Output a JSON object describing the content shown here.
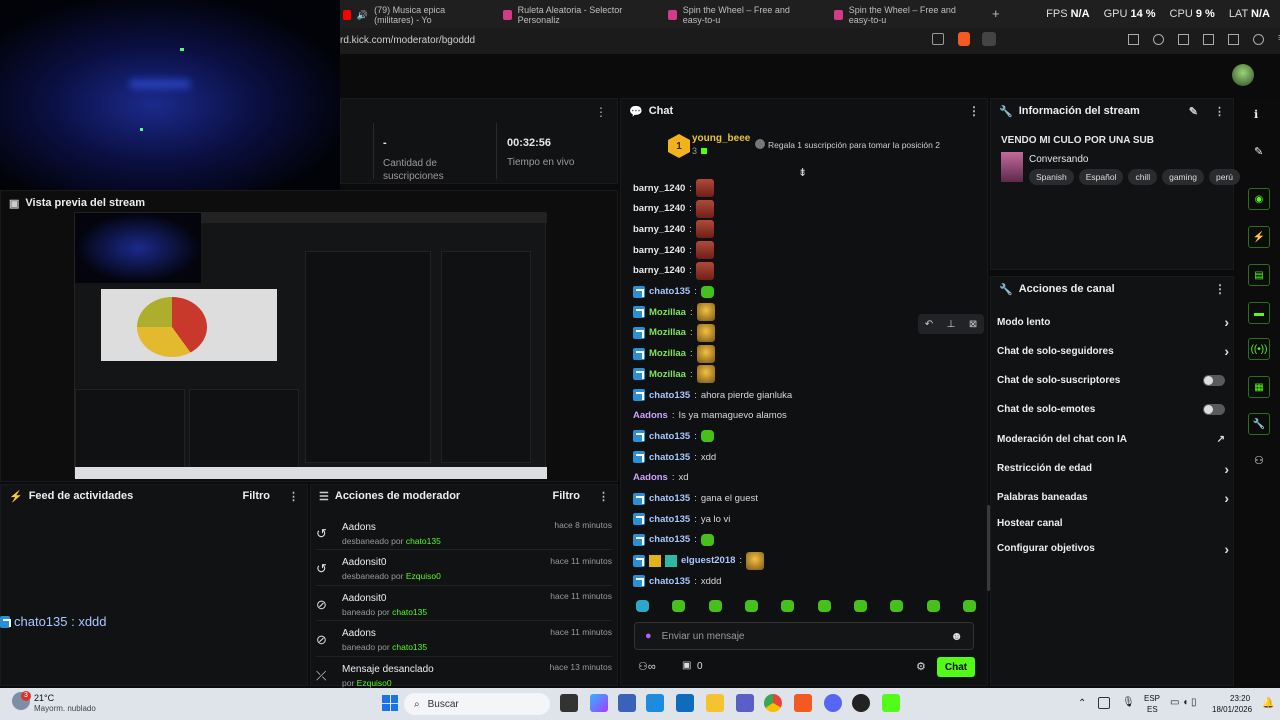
{
  "browser": {
    "tabs": [
      {
        "label": "(79) Musica epica (militares) - Yo",
        "color": "#ff0000"
      },
      {
        "label": "Ruleta Aleatoria - Selector Personaliz",
        "color": "#d23b8a"
      },
      {
        "label": "Spin the Wheel – Free and easy-to-u",
        "color": "#d23b8a"
      },
      {
        "label": "Spin the Wheel – Free and easy-to-u",
        "color": "#d23b8a"
      }
    ],
    "new_tab": "+",
    "url": "rd.kick.com/moderator/bgoddd",
    "stats": {
      "fps_label": "FPS",
      "fps": "N/A",
      "gpu_label": "GPU",
      "gpu": "14 %",
      "cpu_label": "CPU",
      "cpu": "9 %",
      "lat_label": "LAT",
      "lat": "N/A"
    }
  },
  "stream_stats": {
    "subs_value": "-",
    "subs_label": "Cantidad de suscripciones",
    "live_value": "00:32:56",
    "live_label": "Tiempo en vivo"
  },
  "preview": {
    "title": "Vista previa del stream"
  },
  "activity_feed": {
    "title": "Feed de actividades",
    "filter": "Filtro",
    "overlay_text": "chato135 : xddd"
  },
  "mod_actions": {
    "title": "Acciones de moderador",
    "filter": "Filtro",
    "items": [
      {
        "user": "Aadons",
        "action": "desbaneado por",
        "by": "chato135",
        "time": "hace 8 minutos",
        "icon": "undo-icon"
      },
      {
        "user": "Aadonsit0",
        "action": "desbaneado por",
        "by": "Ezquiso0",
        "time": "hace 11 minutos",
        "icon": "undo-icon"
      },
      {
        "user": "Aadonsit0",
        "action": "baneado por",
        "by": "chato135",
        "time": "hace 11 minutos",
        "icon": "ban-icon"
      },
      {
        "user": "Aadons",
        "action": "baneado por",
        "by": "chato135",
        "time": "hace 11 minutos",
        "icon": "ban-icon"
      },
      {
        "user": "Mensaje desanclado",
        "action": "por",
        "by": "Ezquiso0",
        "time": "hace 13 minutos",
        "icon": "unpin-icon"
      }
    ]
  },
  "chat": {
    "title": "Chat",
    "pinned_user": "young_beee",
    "pinned_count": "3",
    "pinned_rank": "1",
    "pinned_promo": "Regala 1 suscripción para tomar la posición 2",
    "messages": [
      {
        "user": "barny_1240",
        "text": "",
        "emote": "red",
        "color": "#e9e9e9",
        "badge": false
      },
      {
        "user": "barny_1240",
        "text": "",
        "emote": "red",
        "color": "#e9e9e9",
        "badge": false
      },
      {
        "user": "barny_1240",
        "text": "",
        "emote": "red",
        "color": "#e9e9e9",
        "badge": false
      },
      {
        "user": "barny_1240",
        "text": "",
        "emote": "red",
        "color": "#e9e9e9",
        "badge": false
      },
      {
        "user": "barny_1240",
        "text": "",
        "emote": "red",
        "color": "#e9e9e9",
        "badge": false
      },
      {
        "user": "chato135",
        "text": "",
        "emote": "green",
        "color": "#a9c7ff",
        "badge": true
      },
      {
        "user": "Mozillaa",
        "text": "",
        "emote": "gold",
        "color": "#7ee35a",
        "badge": true
      },
      {
        "user": "Mozillaa",
        "text": "",
        "emote": "gold",
        "color": "#7ee35a",
        "badge": true
      },
      {
        "user": "Mozillaa",
        "text": "",
        "emote": "gold",
        "color": "#7ee35a",
        "badge": true
      },
      {
        "user": "Mozillaa",
        "text": "",
        "emote": "gold",
        "color": "#7ee35a",
        "badge": true
      },
      {
        "user": "chato135",
        "text": "ahora pierde gianluka",
        "emote": "",
        "color": "#a9c7ff",
        "badge": true
      },
      {
        "user": "Aadons",
        "text": "Is ya mamaguevo alamos",
        "emote": "",
        "color": "#c9a3ff",
        "badge": false
      },
      {
        "user": "chato135",
        "text": "",
        "emote": "green",
        "color": "#a9c7ff",
        "badge": true
      },
      {
        "user": "chato135",
        "text": "xdd",
        "emote": "",
        "color": "#a9c7ff",
        "badge": true
      },
      {
        "user": "Aadons",
        "text": "xd",
        "emote": "",
        "color": "#c9a3ff",
        "badge": false
      },
      {
        "user": "chato135",
        "text": "gana el guest",
        "emote": "",
        "color": "#a9c7ff",
        "badge": true
      },
      {
        "user": "chato135",
        "text": "ya lo vi",
        "emote": "",
        "color": "#a9c7ff",
        "badge": true
      },
      {
        "user": "chato135",
        "text": "",
        "emote": "green",
        "color": "#a9c7ff",
        "badge": true
      },
      {
        "user": "elguest2018",
        "text": "",
        "emote": "gold",
        "color": "#a9c7ff",
        "badge": true
      },
      {
        "user": "chato135",
        "text": "xddd",
        "emote": "",
        "color": "#a9c7ff",
        "badge": true
      }
    ],
    "input_placeholder": "Enviar un mensaje",
    "viewer_count": "0",
    "send_label": "Chat"
  },
  "stream_info": {
    "title": "Información del stream",
    "stream_title": "VENDO MI CULO POR UNA SUB",
    "category": "Conversando",
    "tags": [
      "Spanish",
      "Español",
      "chill",
      "gaming",
      "perú"
    ]
  },
  "channel_actions": {
    "title": "Acciones de canal",
    "items": [
      {
        "label": "Modo lento",
        "control": "chevron"
      },
      {
        "label": "Chat de solo-seguidores",
        "control": "chevron"
      },
      {
        "label": "Chat de solo-suscriptores",
        "control": "toggle"
      },
      {
        "label": "Chat de solo-emotes",
        "control": "toggle"
      },
      {
        "label": "Moderación del chat con IA",
        "control": "external"
      },
      {
        "label": "Restricción de edad",
        "control": "chevron"
      },
      {
        "label": "Palabras baneadas",
        "control": "chevron"
      },
      {
        "label": "Hostear canal",
        "control": "none"
      },
      {
        "label": "Configurar objetivos",
        "control": "chevron"
      }
    ]
  },
  "taskbar": {
    "weather_temp": "21°C",
    "weather_desc": "Mayorm. nublado",
    "search": "Buscar",
    "lang1": "ESP",
    "lang2": "ES",
    "time": "23:20",
    "date": "18/01/2026",
    "notif_badge": "3"
  }
}
